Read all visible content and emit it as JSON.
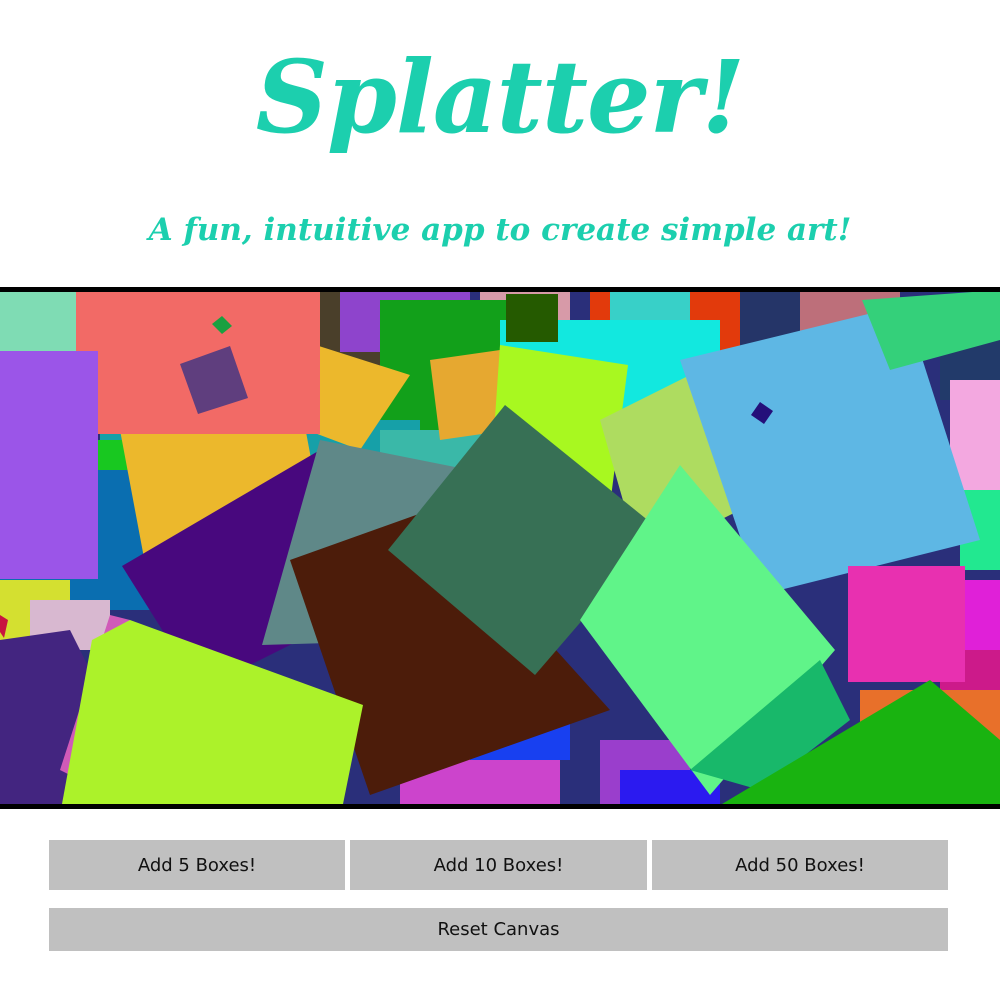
{
  "colors": {
    "accent": "#1ccfae",
    "button_bg": "#c0c0c0",
    "canvas_border": "#000000"
  },
  "header": {
    "title": "Splatter!",
    "subtitle": "A fun, intuitive app to create simple art!"
  },
  "controls": {
    "add5_label": "Add 5 Boxes!",
    "add10_label": "Add 10 Boxes!",
    "add50_label": "Add 50 Boxes!",
    "reset_label": "Reset Canvas"
  }
}
